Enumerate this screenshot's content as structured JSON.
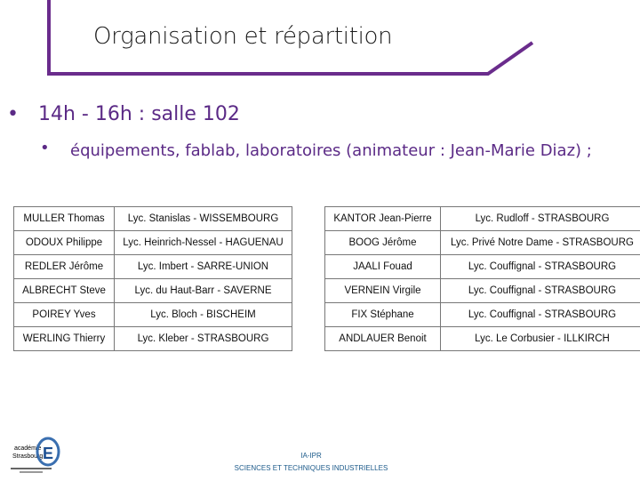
{
  "header": {
    "title": "Organisation et répartition",
    "accent": "#6a2c8c"
  },
  "bullets": [
    {
      "marker": "•",
      "text": "14h - 16h : salle 102"
    },
    {
      "marker": "•",
      "text": "équipements, fablab, laboratoires (animateur : Jean-Marie Diaz) ;"
    }
  ],
  "tables": [
    {
      "rows": [
        [
          "MULLER Thomas",
          "Lyc. Stanislas - WISSEMBOURG"
        ],
        [
          "ODOUX Philippe",
          "Lyc. Heinrich-Nessel - HAGUENAU"
        ],
        [
          "REDLER Jérôme",
          "Lyc. Imbert - SARRE-UNION"
        ],
        [
          "ALBRECHT Steve",
          "Lyc. du Haut-Barr - SAVERNE"
        ],
        [
          "POIREY Yves",
          "Lyc. Bloch - BISCHEIM"
        ],
        [
          "WERLING Thierry",
          "Lyc. Kleber - STRASBOURG"
        ]
      ]
    },
    {
      "rows": [
        [
          "KANTOR Jean-Pierre",
          "Lyc. Rudloff - STRASBOURG"
        ],
        [
          "BOOG Jérôme",
          "Lyc. Privé Notre Dame - STRASBOURG"
        ],
        [
          "JAALI Fouad",
          "Lyc. Couffignal - STRASBOURG"
        ],
        [
          "VERNEIN Virgile",
          "Lyc. Couffignal - STRASBOURG"
        ],
        [
          "FIX Stéphane",
          "Lyc. Couffignal - STRASBOURG"
        ],
        [
          "ANDLAUER Benoit",
          "Lyc. Le Corbusier - ILLKIRCH"
        ]
      ]
    }
  ],
  "footer": {
    "line1": "IA-IPR",
    "line2": "SCIENCES ET TECHNIQUES INDUSTRIELLES"
  },
  "logo": {
    "text": "académie Strasbourg É",
    "icon": "academie-logo"
  }
}
